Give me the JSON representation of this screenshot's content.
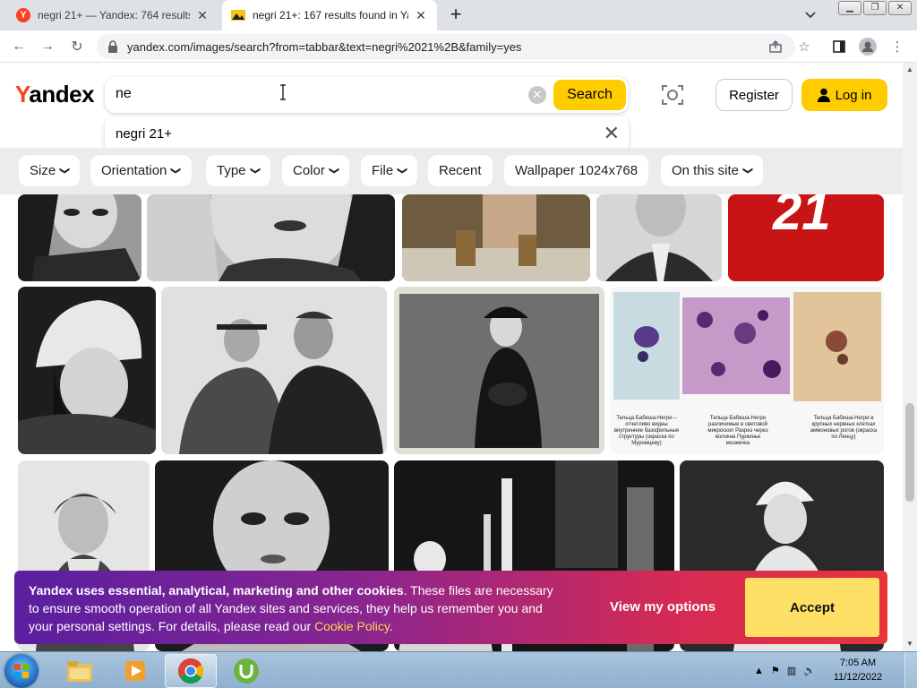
{
  "browser": {
    "tabs": [
      {
        "title": "negri 21+ — Yandex: 764 results",
        "favicon": "yandex-favicon",
        "active": false
      },
      {
        "title": "negri 21+: 167 results found in Ya",
        "favicon": "image-favicon",
        "active": true
      }
    ],
    "new_tab": "+",
    "url": "yandex.com/images/search?from=tabbar&text=negri%2021%2B&family=yes"
  },
  "yandex": {
    "logo": "Yandex",
    "logo_first": "Y",
    "logo_rest": "andex",
    "search": {
      "query": "ne",
      "button": "Search"
    },
    "suggestion": "negri 21+",
    "register": "Register",
    "login": "Log in"
  },
  "filters": [
    {
      "label": "Size",
      "dropdown": true
    },
    {
      "label": "Orientation",
      "dropdown": true
    },
    {
      "label": "Type",
      "dropdown": true
    },
    {
      "label": "Color",
      "dropdown": true
    },
    {
      "label": "File",
      "dropdown": true
    },
    {
      "label": "Recent",
      "dropdown": false
    },
    {
      "label": "Wallpaper 1024x768",
      "dropdown": false
    },
    {
      "label": "On this site",
      "dropdown": true
    }
  ],
  "images": {
    "medical_captions": [
      "Тельца Бабеша-Негри – отчетливо видны внутренние базофильные структуры (окраска по Муромцеву)",
      "Тельца Бабеша-Негри различимые в световой микроскоп Разрез через волокна Пуркинье мозжечка",
      "Тельца Бабеша-Негри в крупных нервных клетках аммоновых рогов (окраска по Ленцу)"
    ],
    "red_tile_text": "21"
  },
  "cookie": {
    "bold": "Yandex uses essential, analytical, marketing and other cookies",
    "text": ". These files are necessary to ensure smooth operation of all Yandex sites and services, they help us remember you and your personal settings. For details, please read our ",
    "link": "Cookie Policy",
    "end": ".",
    "view_options": "View my options",
    "accept": "Accept"
  },
  "taskbar": {
    "time": "7:05 AM",
    "date": "11/12/2022"
  }
}
